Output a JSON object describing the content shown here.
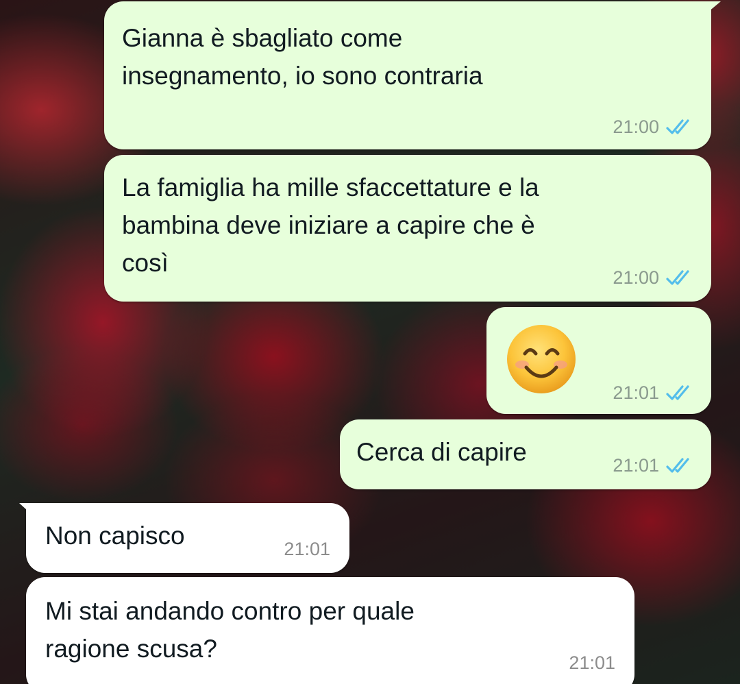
{
  "chat": {
    "messages": [
      {
        "direction": "outgoing",
        "text": "Gianna è sbagliato come\ninsegnamento, io sono contraria",
        "time": "21:00",
        "status": "read"
      },
      {
        "direction": "outgoing",
        "text": "La famiglia ha mille sfaccettature e la\nbambina deve iniziare a capire che è\ncosì",
        "time": "21:00",
        "status": "read"
      },
      {
        "direction": "outgoing",
        "emoji": "smiling-face-with-smiling-eyes",
        "time": "21:01",
        "status": "read"
      },
      {
        "direction": "outgoing",
        "text": "Cerca di capire",
        "time": "21:01",
        "status": "read"
      },
      {
        "direction": "incoming",
        "text": "Non capisco",
        "time": "21:01"
      },
      {
        "direction": "incoming",
        "text": "Mi stai andando contro per quale\nragione scusa?",
        "time": "21:01"
      }
    ]
  },
  "theme": {
    "outgoing_bubble": "#e7ffdb",
    "incoming_bubble": "#ffffff",
    "read_tick": "#53bdeb",
    "background": "dark red roses wallpaper"
  }
}
